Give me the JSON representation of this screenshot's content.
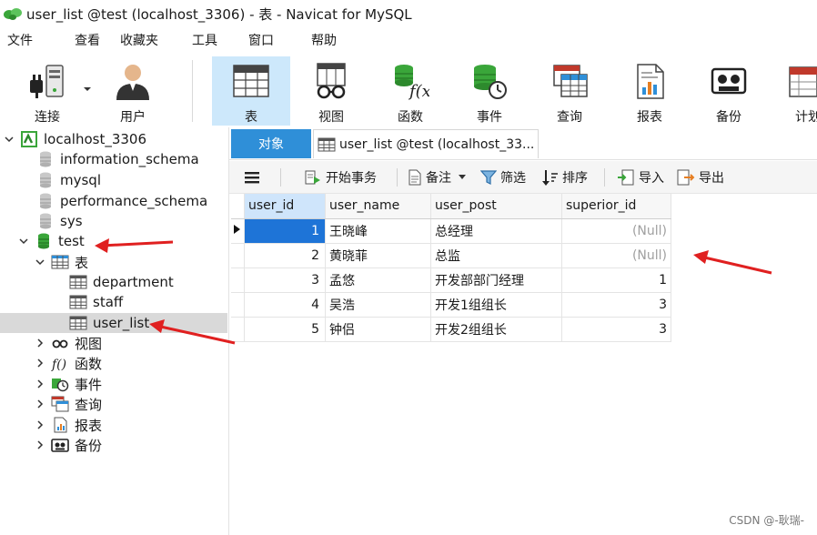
{
  "window": {
    "title": "user_list @test (localhost_3306) - 表 - Navicat for MySQL"
  },
  "menu": [
    "文件",
    "查看",
    "收藏夹",
    "工具",
    "窗口",
    "帮助"
  ],
  "toolbar": {
    "connect": "连接",
    "user": "用户",
    "table": "表",
    "view": "视图",
    "function": "函数",
    "event": "事件",
    "query": "查询",
    "report": "报表",
    "backup": "备份",
    "schedule": "计划"
  },
  "tree": {
    "connection": "localhost_3306",
    "databases": [
      "information_schema",
      "mysql",
      "performance_schema",
      "sys",
      "test"
    ],
    "tables_label": "表",
    "tables": [
      "department",
      "staff",
      "user_list"
    ],
    "groups": [
      "视图",
      "函数",
      "事件",
      "查询",
      "报表",
      "备份"
    ]
  },
  "tabs": {
    "objects": "对象",
    "current": "user_list @test (localhost_33..."
  },
  "subtoolbar": {
    "transaction": "开始事务",
    "memo": "备注",
    "filter": "筛选",
    "sort": "排序",
    "import": "导入",
    "export": "导出"
  },
  "grid": {
    "columns": [
      "user_id",
      "user_name",
      "user_post",
      "superior_id"
    ],
    "rows": [
      [
        "1",
        "王晓峰",
        "总经理",
        "(Null)"
      ],
      [
        "2",
        "黄晓菲",
        "总监",
        "(Null)"
      ],
      [
        "3",
        "孟悠",
        "开发部部门经理",
        "1"
      ],
      [
        "4",
        "吴浩",
        "开发1组组长",
        "3"
      ],
      [
        "5",
        "钟侣",
        "开发2组组长",
        "3"
      ]
    ]
  },
  "watermark": "CSDN @-耿瑞-",
  "colors": {
    "accent": "#2f8fd8",
    "selected_cell": "#1e74d7",
    "active_tool": "#cde8fb",
    "annotation_arrow": "#e02020"
  }
}
